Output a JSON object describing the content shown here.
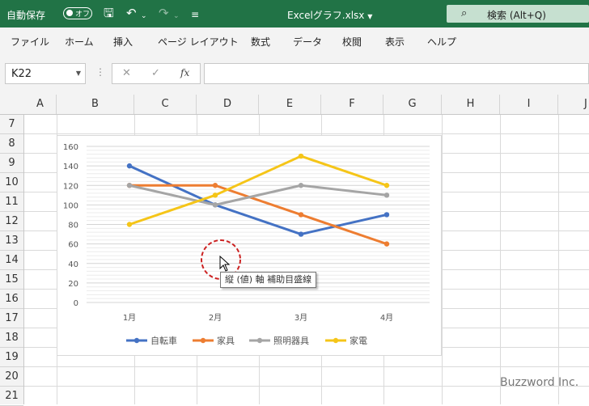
{
  "titlebar": {
    "autosave_label": "自動保存",
    "autosave_state": "オフ",
    "filename": "Excelグラフ.xlsx",
    "search_label": "検索 (Alt+Q)"
  },
  "ribbon_tabs": [
    "ファイル",
    "ホーム",
    "挿入",
    "ページ レイアウト",
    "数式",
    "データ",
    "校閲",
    "表示",
    "ヘルプ"
  ],
  "formula_bar": {
    "name_box": "K22",
    "fx": "fx",
    "formula": ""
  },
  "columns": [
    "A",
    "B",
    "C",
    "D",
    "E",
    "F",
    "G",
    "H",
    "I",
    "J"
  ],
  "rows": [
    "7",
    "8",
    "9",
    "10",
    "11",
    "12",
    "13",
    "14",
    "15",
    "16",
    "17",
    "18",
    "19",
    "20",
    "21"
  ],
  "chart_data": {
    "type": "line",
    "categories": [
      "1月",
      "2月",
      "3月",
      "4月"
    ],
    "series": [
      {
        "name": "自転車",
        "color": "#4472c4",
        "values": [
          140,
          100,
          70,
          90
        ]
      },
      {
        "name": "家具",
        "color": "#ed7d31",
        "values": [
          120,
          120,
          90,
          60
        ]
      },
      {
        "name": "照明器具",
        "color": "#a5a5a5",
        "values": [
          120,
          100,
          120,
          110
        ]
      },
      {
        "name": "家電",
        "color": "#f5c518",
        "values": [
          80,
          110,
          150,
          120
        ]
      }
    ],
    "yticks": [
      "0",
      "20",
      "40",
      "60",
      "80",
      "100",
      "120",
      "140",
      "160"
    ],
    "ylim": [
      0,
      160
    ],
    "minor_gridlines": true,
    "legend": "bottom"
  },
  "tooltip": "縦 (値) 軸 補助目盛線",
  "watermark": "Buzzword Inc."
}
